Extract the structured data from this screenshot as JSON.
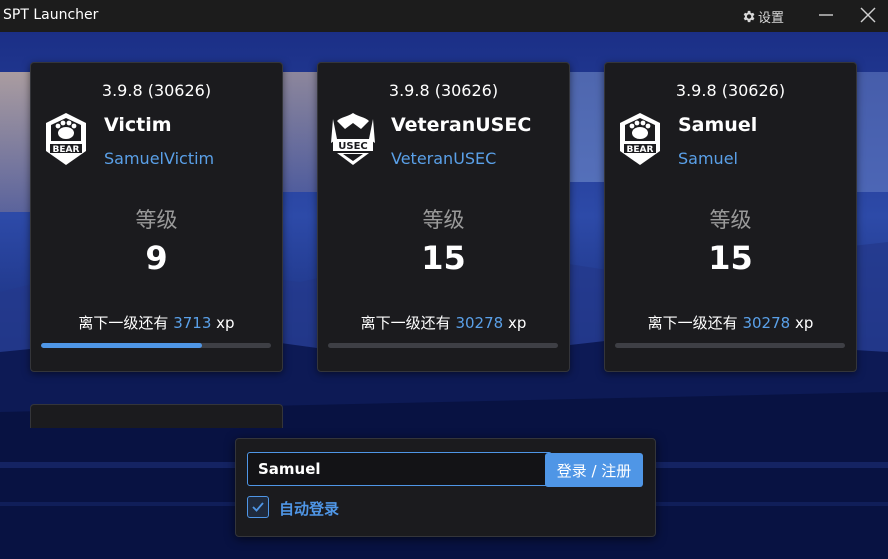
{
  "window": {
    "title": "SPT Launcher",
    "settings_label": "设置",
    "settings_icon": "gear-icon",
    "minimize_icon": "minimize-icon",
    "close_icon": "close-icon"
  },
  "profiles": [
    {
      "version": "3.9.8 (30626)",
      "faction": "BEAR",
      "name": "Victim",
      "username": "SamuelVictim",
      "level_label": "等级",
      "level": "9",
      "xp_prefix": "离下一级还有",
      "xp_remaining": "3713",
      "xp_suffix": "xp",
      "xp_progress": 0.7
    },
    {
      "version": "3.9.8 (30626)",
      "faction": "USEC",
      "name": "VeteranUSEC",
      "username": "VeteranUSEC",
      "level_label": "等级",
      "level": "15",
      "xp_prefix": "离下一级还有",
      "xp_remaining": "30278",
      "xp_suffix": "xp",
      "xp_progress": 0.0
    },
    {
      "version": "3.9.8 (30626)",
      "faction": "BEAR",
      "name": "Samuel",
      "username": "Samuel",
      "level_label": "等级",
      "level": "15",
      "xp_prefix": "离下一级还有",
      "xp_remaining": "30278",
      "xp_suffix": "xp",
      "xp_progress": 0.0
    }
  ],
  "login": {
    "username_value": "Samuel",
    "button_label": "登录 / 注册",
    "auto_login_label": "自动登录",
    "auto_login_checked": true
  },
  "colors": {
    "accent": "#4f96e6",
    "card_bg": "#1b1b1e",
    "titlebar_bg": "#1c1c1c",
    "muted_text": "#9a9a9a"
  }
}
